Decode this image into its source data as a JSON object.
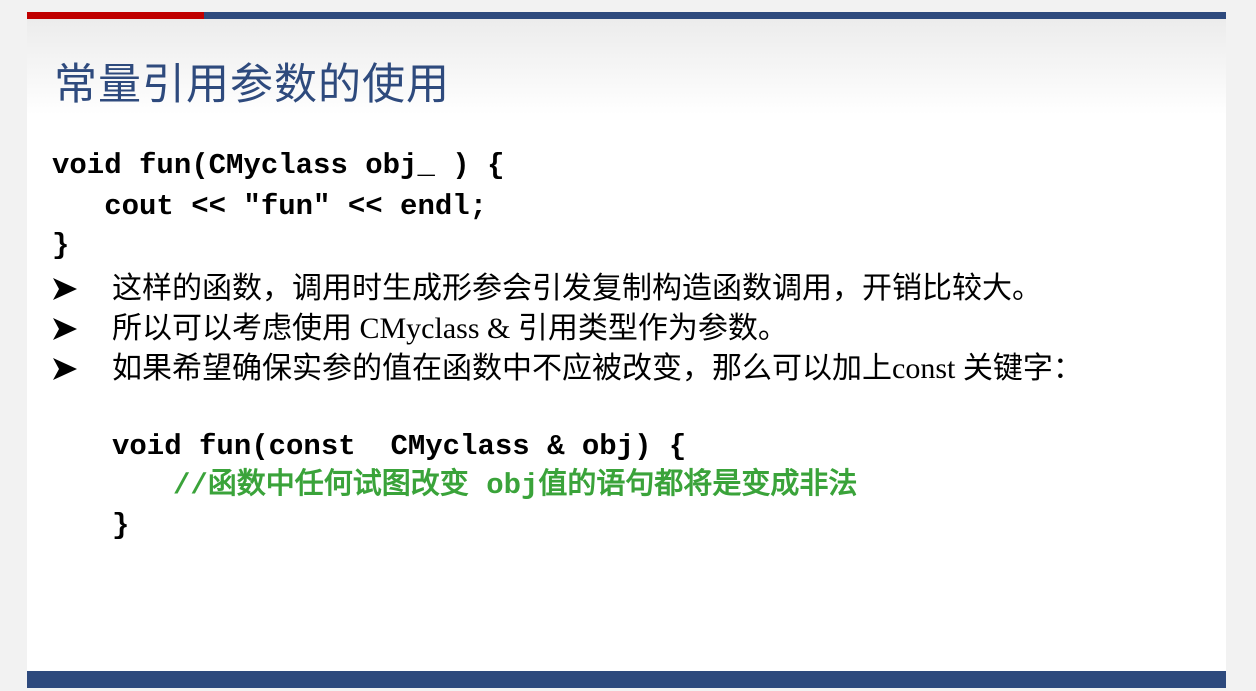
{
  "slide": {
    "title": "常量引用参数的使用",
    "code_block_1": {
      "line1": "void fun(CMyclass obj_ ) {",
      "line2": "   cout << \"fun\" << endl;",
      "line3": "}"
    },
    "bullets": [
      {
        "marker": "arrowhead-bullet",
        "text": "这样的函数，调用时生成形参会引发复制构造函数调用，开销比较大。"
      },
      {
        "marker": "arrowhead-bullet",
        "text": "所以可以考虑使用 CMyclass & 引用类型作为参数。"
      },
      {
        "marker": "arrowhead-bullet",
        "text": "如果希望确保实参的值在函数中不应被改变，那么可以加上const 关键字："
      }
    ],
    "code_block_2": {
      "line1": "void fun(const  CMyclass & obj) {",
      "comment": "//函数中任何试图改变 obj值的语句都将是变成非法",
      "line3": "}"
    }
  },
  "colors": {
    "title": "#2e4a7d",
    "top_bar_blue": "#2e4a7d",
    "top_bar_red": "#c00000",
    "bottom_bar": "#2e4a7d",
    "comment": "#3aa33a"
  }
}
